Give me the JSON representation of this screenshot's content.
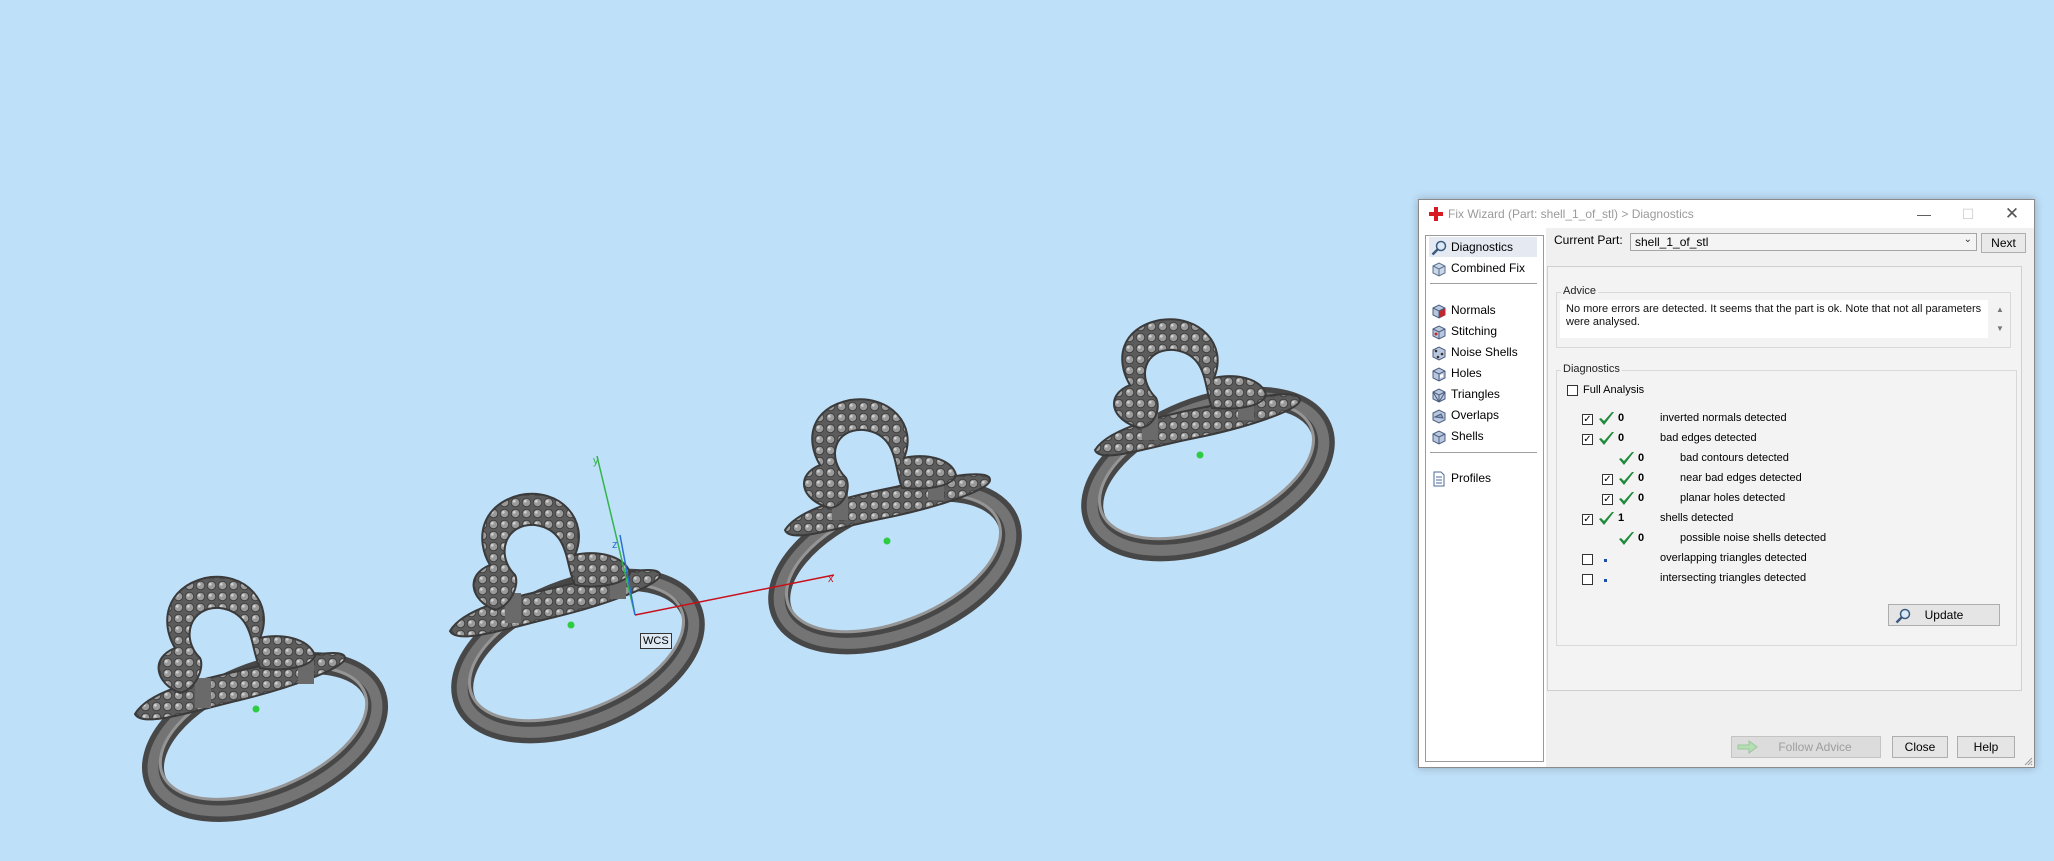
{
  "viewport": {
    "wcs_label": "WCS",
    "axis_labels": {
      "x": "x",
      "y": "y",
      "z": "z"
    },
    "colors": {
      "background": "#bfe0f9",
      "ring_metal": "#6a6a6a",
      "x_axis": "#c8101a",
      "y_axis": "#34b34a",
      "z_axis": "#2b6fd6"
    }
  },
  "dialog": {
    "title": "Fix Wizard (Part: shell_1_of_stl) > Diagnostics",
    "window_buttons": {
      "minimize": "—",
      "maximize": "☐",
      "close": "✕"
    },
    "nav": [
      {
        "label": "Diagnostics",
        "icon": "magnifier-icon",
        "selected": true
      },
      {
        "label": "Combined Fix",
        "icon": "combined-fix-icon"
      },
      {
        "label": "Normals",
        "icon": "normals-cube-icon"
      },
      {
        "label": "Stitching",
        "icon": "stitching-cube-icon"
      },
      {
        "label": "Noise Shells",
        "icon": "noise-shells-cube-icon"
      },
      {
        "label": "Holes",
        "icon": "holes-cube-icon"
      },
      {
        "label": "Triangles",
        "icon": "triangles-cube-icon"
      },
      {
        "label": "Overlaps",
        "icon": "overlaps-cube-icon"
      },
      {
        "label": "Shells",
        "icon": "shells-cube-icon"
      },
      {
        "label": "Profiles",
        "icon": "profiles-document-icon"
      }
    ],
    "current_part_label": "Current Part:",
    "current_part_value": "shell_1_of_stl",
    "next_label": "Next",
    "advice": {
      "title": "Advice",
      "text": "No more errors are detected. It seems that the part is ok. Note that not all parameters were analysed."
    },
    "diagnostics": {
      "title": "Diagnostics",
      "full_analysis_label": "Full Analysis",
      "full_analysis_checked": false,
      "rows": [
        {
          "checkbox": true,
          "checked": true,
          "status": "ok",
          "count": "0",
          "label": "inverted normals detected",
          "indent": 0
        },
        {
          "checkbox": true,
          "checked": true,
          "status": "ok",
          "count": "0",
          "label": "bad edges detected",
          "indent": 0
        },
        {
          "checkbox": false,
          "checked": false,
          "status": "ok",
          "count": "0",
          "label": "bad contours detected",
          "indent": 1
        },
        {
          "checkbox": true,
          "checked": true,
          "status": "ok",
          "count": "0",
          "label": "near bad edges detected",
          "indent": 1
        },
        {
          "checkbox": true,
          "checked": true,
          "status": "ok",
          "count": "0",
          "label": "planar holes detected",
          "indent": 1
        },
        {
          "checkbox": true,
          "checked": true,
          "status": "ok",
          "count": "1",
          "label": "shells detected",
          "indent": 0
        },
        {
          "checkbox": false,
          "checked": false,
          "status": "ok",
          "count": "0",
          "label": "possible noise shells detected",
          "indent": 1
        },
        {
          "checkbox": true,
          "checked": false,
          "status": "unknown",
          "count": "",
          "label": "overlapping triangles detected",
          "indent": 0
        },
        {
          "checkbox": true,
          "checked": false,
          "status": "unknown",
          "count": "",
          "label": "intersecting triangles detected",
          "indent": 0
        }
      ]
    },
    "update_label": "Update",
    "follow_advice_label": "Follow Advice",
    "close_label": "Close",
    "help_label": "Help"
  }
}
